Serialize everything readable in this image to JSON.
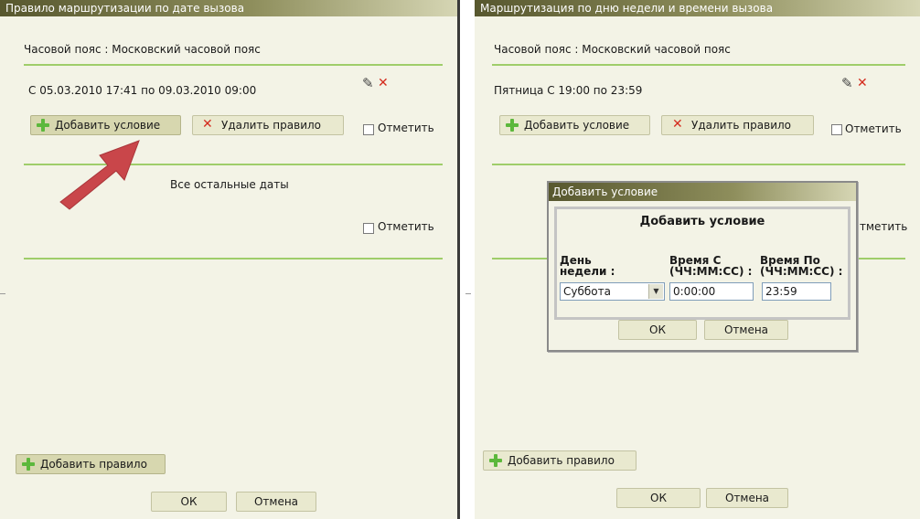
{
  "left": {
    "title": "Правило маршрутизации по дате вызова",
    "timezone": "Часовой пояс : Московский часовой пояс",
    "rule_text": "С 05.03.2010 17:41 по 09.03.2010 09:00",
    "add_condition": "Добавить условие",
    "delete_rule": "Удалить правило",
    "mark": "Отметить",
    "other_dates": "Все остальные даты",
    "mark2": "Отметить",
    "add_rule": "Добавить правило",
    "ok": "ОК",
    "cancel": "Отмена"
  },
  "right": {
    "title": "Маршрутизация по дню недели и времени вызова",
    "timezone": "Часовой пояс : Московский часовой пояс",
    "rule_text": "Пятница С 19:00 по 23:59",
    "add_condition": "Добавить условие",
    "delete_rule": "Удалить правило",
    "mark": "Отметить",
    "mark2_partial": "тметить",
    "add_rule": "Добавить правило",
    "ok": "ОК",
    "cancel": "Отмена"
  },
  "dialog": {
    "title": "Добавить условие",
    "heading": "Добавить условие",
    "day_label_1": "День",
    "day_label_2": "недели :",
    "from_label_1": "Время С",
    "from_label_2": "(ЧЧ:ММ:СС) :",
    "to_label_1": "Время По",
    "to_label_2": "(ЧЧ:ММ:СС) :",
    "day_value": "Суббота",
    "from_value": "0:00:00",
    "to_value": "23:59",
    "ok": "ОК",
    "cancel": "Отмена"
  },
  "icons": {
    "edit": "pencil-icon",
    "delete": "delete-x-icon",
    "add": "plus-icon",
    "pointer": "red-arrow"
  },
  "colors": {
    "titlebar": "#57572e",
    "panel_bg": "#f3f3e6",
    "separator": "#9fcd6a",
    "plus": "#5cb83c",
    "delete": "#d42c1e",
    "arrow": "#c9464a"
  }
}
